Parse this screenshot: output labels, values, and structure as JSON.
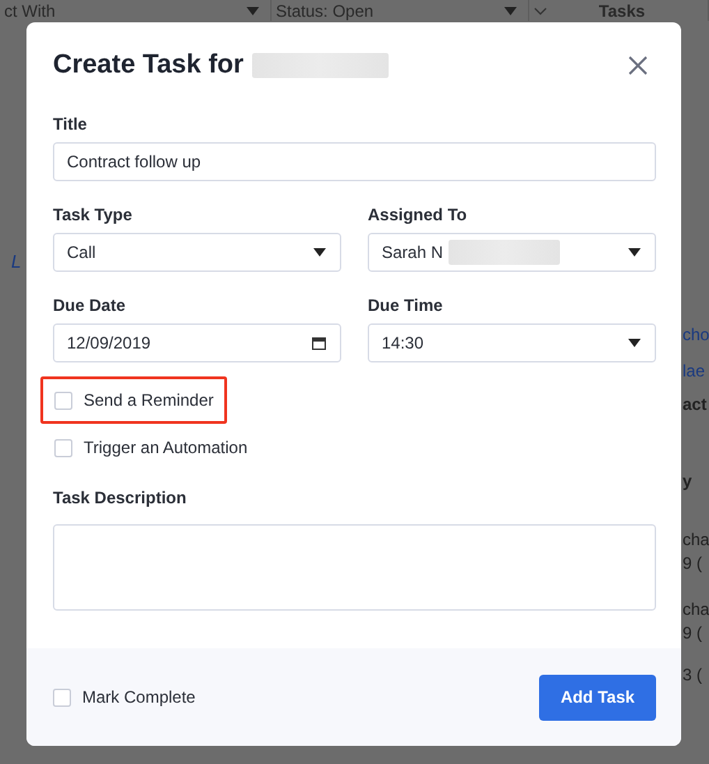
{
  "background": {
    "header": [
      {
        "label": "ct With",
        "kind": "dropdown"
      },
      {
        "label": "Status: Open",
        "kind": "dropdown"
      },
      {
        "label": "Tasks",
        "kind": "section"
      }
    ],
    "left_fragments": [
      "L"
    ],
    "right_fragments": [
      {
        "text": "cho",
        "kind": "link"
      },
      {
        "text": "lae",
        "kind": "link"
      },
      {
        "text": "act",
        "kind": "bold"
      },
      {
        "text": "y",
        "kind": "bold"
      },
      {
        "text": "cha",
        "kind": "plain"
      },
      {
        "text": "9 (",
        "kind": "plain"
      },
      {
        "text": "cha",
        "kind": "plain"
      },
      {
        "text": "9 (",
        "kind": "plain"
      },
      {
        "text": "3 (",
        "kind": "plain"
      }
    ]
  },
  "dialog": {
    "title": "Create Task for",
    "fields": [
      {
        "label": "Title",
        "kind": "text",
        "value": "Contract follow up"
      },
      {
        "label": "Task Type",
        "kind": "select",
        "value": "Call"
      },
      {
        "label": "Assigned To",
        "kind": "select",
        "value": "Sarah N",
        "redacted": true
      },
      {
        "label": "Due Date",
        "kind": "date",
        "value": "12/09/2019"
      },
      {
        "label": "Due Time",
        "kind": "select",
        "value": "14:30"
      }
    ],
    "options": [
      {
        "label": "Send a Reminder",
        "checked": false,
        "highlighted": true
      },
      {
        "label": "Trigger an Automation",
        "checked": false,
        "highlighted": false
      }
    ],
    "description": {
      "label": "Task Description"
    },
    "footer": {
      "mark_complete": {
        "label": "Mark Complete",
        "checked": false
      },
      "button": "Add Task"
    }
  }
}
